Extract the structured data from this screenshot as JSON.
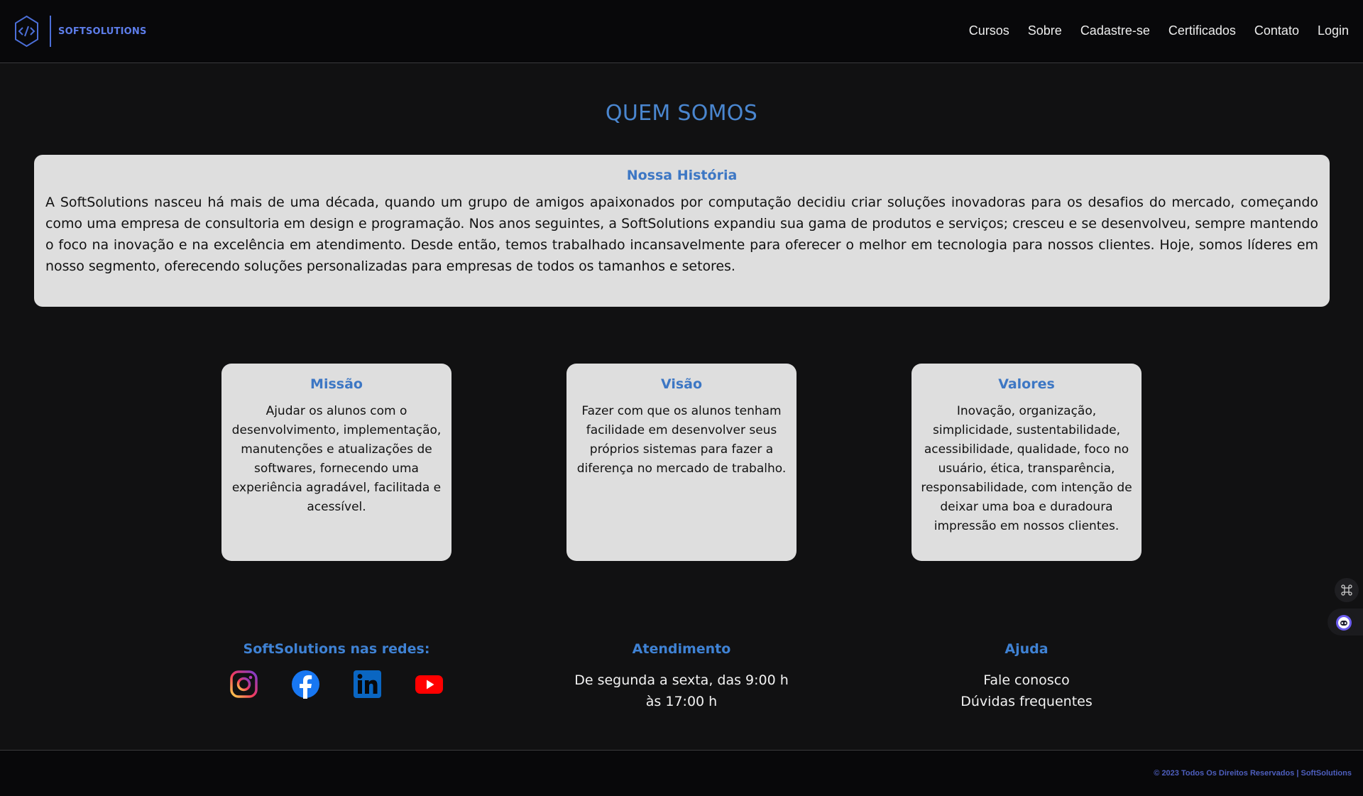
{
  "brand": {
    "name": "SOFTSOLUTIONS",
    "logo_icon": "code-hexagon-icon",
    "accent": "#4c6fd8"
  },
  "nav": {
    "items": [
      {
        "label": "Cursos"
      },
      {
        "label": "Sobre"
      },
      {
        "label": "Cadastre-se"
      },
      {
        "label": "Certificados"
      },
      {
        "label": "Contato"
      },
      {
        "label": "Login"
      }
    ]
  },
  "main": {
    "title": "QUEM SOMOS",
    "history": {
      "heading": "Nossa História",
      "text": "A SoftSolutions nasceu há mais de uma década, quando um grupo de amigos apaixonados por computação decidiu criar soluções inovadoras para os desafios do mercado, começando como uma empresa de consultoria em design e programação. Nos anos seguintes, a SoftSolutions expandiu sua gama de produtos e serviços; cresceu e se desenvolveu, sempre mantendo o foco na inovação e na excelência em atendimento. Desde então, temos trabalhado incansavelmente para oferecer o melhor em tecnologia para nossos clientes. Hoje, somos líderes em nosso segmento, oferecendo soluções personalizadas para empresas de todos os tamanhos e setores."
    },
    "cards": [
      {
        "heading": "Missão",
        "text": "Ajudar os alunos com o desenvolvimento, implementação, manutenções e atualizações de softwares, fornecendo uma experiência agradável, facilitada e acessível."
      },
      {
        "heading": "Visão",
        "text": "Fazer com que os alunos tenham facilidade em desenvolver seus próprios sistemas para fazer a diferença no mercado de trabalho."
      },
      {
        "heading": "Valores",
        "text": "Inovação, organização, simplicidade, sustentabilidade, acessibilidade, qualidade, foco no usuário, ética, transparência, responsabilidade, com intenção de deixar uma boa e duradoura impressão em nossos clientes."
      }
    ]
  },
  "footer": {
    "social": {
      "title": "SoftSolutions nas redes:",
      "icons": [
        "instagram-icon",
        "facebook-icon",
        "linkedin-icon",
        "youtube-icon"
      ]
    },
    "atendimento": {
      "title": "Atendimento",
      "text": "De segunda a sexta, das 9:00 h às 17:00 h"
    },
    "ajuda": {
      "title": "Ajuda",
      "links": [
        "Fale conosco",
        "Dúvidas frequentes"
      ]
    },
    "copyright": "© 2023 Todos Os Direitos Reservados | SoftSolutions"
  },
  "widgets": [
    "shortcut-icon",
    "assistant-bot-icon"
  ],
  "colors": {
    "background": "#111112",
    "header": "#08080a",
    "heading_blue": "#4a86cf",
    "card_bg": "#dedede",
    "copyright": "#4e5fbf"
  }
}
